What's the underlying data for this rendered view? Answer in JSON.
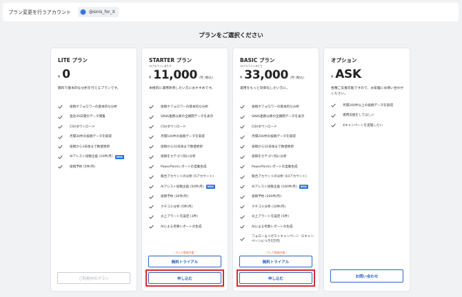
{
  "topbar": {
    "label": "プラン変更を行うアカウント",
    "account": "@sinis_for_X"
  },
  "heading": "プランをご選択ください",
  "new_badge": "NEW",
  "plans": [
    {
      "name": "LITE プラン",
      "per_month": "",
      "yen": "¥",
      "price": "0",
      "unit": "",
      "description": "無料で基本的な分析を行えるプランです。",
      "features": [
        "投稿やフォロワーの基本的な分析",
        "直近45日間のデータ閲覧",
        "CSVダウンロード",
        "月間30件の投稿データを取得",
        "投稿から3日後まで数値更新",
        "AIアシスト投稿企画 (10件/月)",
        "投稿予約 (5件/月)"
      ],
      "buttons": {
        "current": "ご利用中のプラン"
      }
    },
    {
      "name": "STARTER プラン",
      "per_month": "1Xアカウントあたり",
      "yen": "¥",
      "price": "11,000",
      "unit": "/月 (税込)",
      "description": "本格的に運用改善したい方におすすめです。",
      "features": [
        "投稿やフォロワーの基本的な分析",
        "SINIS連携以降の全期間データを表示",
        "CSVダウンロード",
        "月間100件の投稿データを取得",
        "投稿から10日後まで数値更新",
        "投稿をカテゴリ別に分析",
        "PowerPointレポートの自動生成",
        "競合アカウントの分析 (5アカウント)",
        "AIアシスト投稿企画 (50件/月)",
        "投稿予約 (30件/月)",
        "クチコミ分析 (5件/月)",
        "炎上アラートを設定 (3件)",
        "AIによる考察レポートの生成"
      ],
      "buttons": {
        "note": "＼クレカ登録不要／",
        "trial": "無料トライアル",
        "apply": "申し込む"
      }
    },
    {
      "name": "BASIC プラン",
      "per_month": "1Xアカウントあたり",
      "yen": "¥",
      "price": "33,000",
      "unit": "/月 (税込)",
      "description": "運用をもっと効率化したい方に。",
      "features": [
        "投稿やフォロワーの基本的な分析",
        "SINIS連携以降の全期間データを表示",
        "CSVダウンロード",
        "月間200件の投稿データを取得",
        "投稿から10日後まで数値更新",
        "投稿をカテゴリ別に分析",
        "PowerPointレポートの自動生成",
        "競合アカウントの分析 (10アカウント)",
        "AIアシスト投稿企画 (100件/月)",
        "投稿予約 (200件/月)",
        "クチコミ分析 (10件/月)",
        "炎上アラートを設定 (5件)",
        "AIによる考察レポートの生成",
        "フォロー＆リポストキャンペーン（1キャンペーンにつき5万円）"
      ],
      "buttons": {
        "note": "＼クレカ登録不要／",
        "trial": "無料トライアル",
        "apply": "申し込む"
      }
    },
    {
      "name": "オプション",
      "per_month": "",
      "yen": "¥",
      "price": "ASK",
      "unit": "",
      "description": "各種ご支援可能ですので、お気軽にお問い合わせください。",
      "features": [
        "月間200件以上の投稿データを取得",
        "運用支援をしてほしい",
        "Xキャンペーンを実施したい"
      ],
      "buttons": {
        "contact": "お問い合わせ"
      }
    }
  ],
  "colors": {
    "accent": "#2b61c4",
    "highlight": "#d62d2d",
    "note": "#e05a2b",
    "check": "#333333"
  }
}
